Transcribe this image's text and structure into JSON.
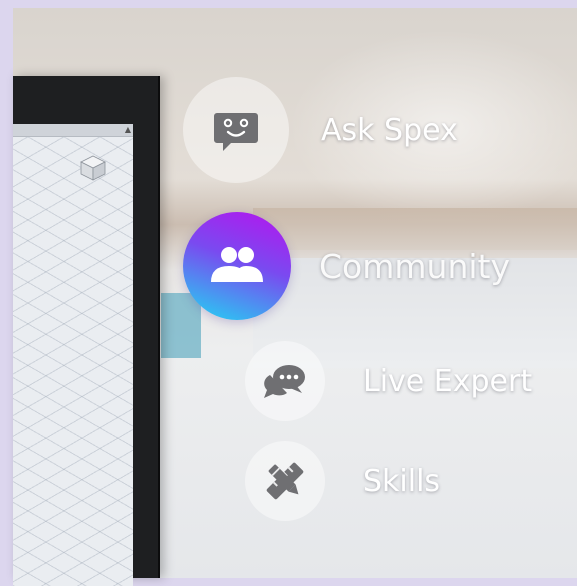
{
  "menu": {
    "ask_spex": {
      "label": "Ask Spex",
      "icon": "robot-chat-icon"
    },
    "community": {
      "label": "Community",
      "icon": "people-icon",
      "gradient": [
        "#b614ee",
        "#20d8f2"
      ]
    },
    "live_expert": {
      "label": "Live Expert",
      "icon": "chat-bubbles-icon"
    },
    "skills": {
      "label": "Skills",
      "icon": "pencil-ruler-icon"
    }
  },
  "colors": {
    "icon_gray": "#6f6f72",
    "label": "#ffffff",
    "frame": "#dcd6ee"
  }
}
